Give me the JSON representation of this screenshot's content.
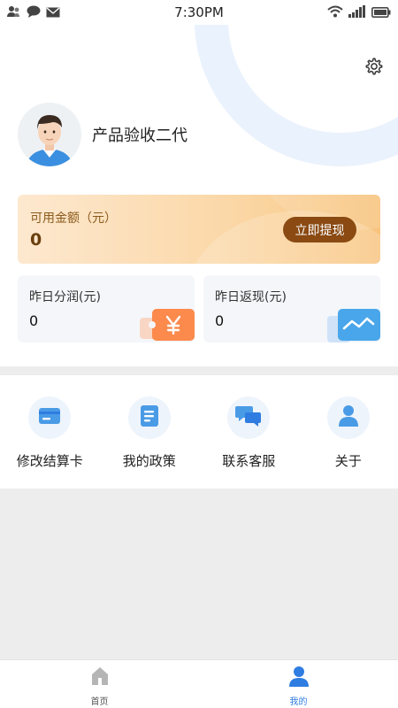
{
  "status_bar": {
    "time": "7:30PM",
    "left_icons": [
      "contacts-icon",
      "chat-icon",
      "mail-icon"
    ],
    "right_icons": [
      "wifi-icon",
      "signal-icon",
      "battery-icon"
    ]
  },
  "profile": {
    "name": "产品验收二代",
    "settings_icon": "gear-icon"
  },
  "balance": {
    "label": "可用金额（元）",
    "value": "0",
    "withdraw_label": "立即提现"
  },
  "stats": {
    "profit": {
      "label": "昨日分润(元)",
      "value": "0",
      "icon": "yen-ticket-icon"
    },
    "cashback": {
      "label": "昨日返现(元)",
      "value": "0",
      "icon": "trend-chart-icon"
    }
  },
  "menu": {
    "items": [
      {
        "label": "修改结算卡",
        "icon": "card-icon"
      },
      {
        "label": "我的政策",
        "icon": "document-icon"
      },
      {
        "label": "联系客服",
        "icon": "chat-bubbles-icon"
      },
      {
        "label": "关于",
        "icon": "person-icon"
      }
    ]
  },
  "nav": {
    "home_label": "首页",
    "mine_label": "我的",
    "active": "mine"
  },
  "colors": {
    "accent_blue": "#2f7de1",
    "balance_gradient": [
      "#fde8cf",
      "#f8c47e"
    ],
    "withdraw_button": "#8a4a12",
    "inactive_nav": "#9a9a9a"
  }
}
